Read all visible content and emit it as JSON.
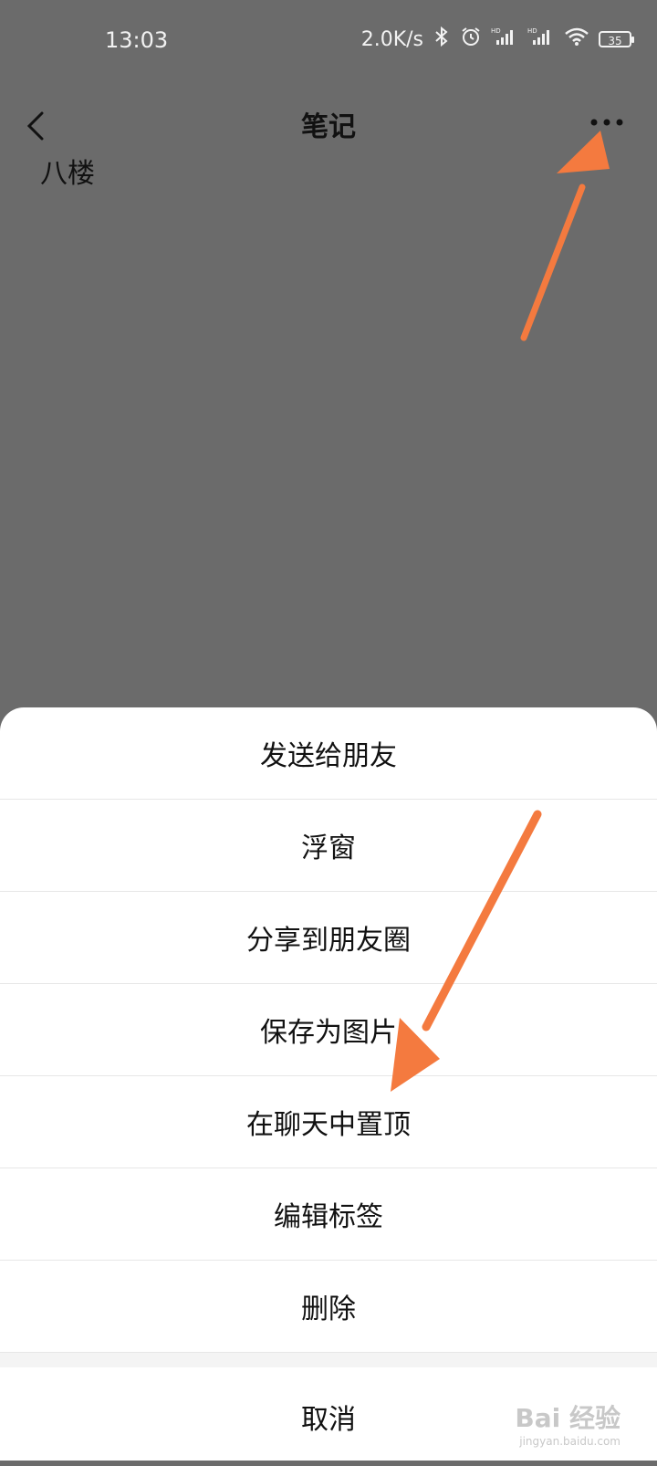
{
  "status_bar": {
    "time": "13:03",
    "net_speed": "2.0K/s",
    "battery": "35",
    "icons": [
      "bluetooth-icon",
      "alarm-icon",
      "signal-hd-icon",
      "signal-hd-icon",
      "wifi-icon",
      "battery-icon"
    ]
  },
  "nav": {
    "title": "笔记"
  },
  "note": {
    "content": "八楼"
  },
  "menu": {
    "items": [
      {
        "label": "发送给朋友"
      },
      {
        "label": "浮窗"
      },
      {
        "label": "分享到朋友圈"
      },
      {
        "label": "保存为图片"
      },
      {
        "label": "在聊天中置顶"
      },
      {
        "label": "编辑标签"
      },
      {
        "label": "删除"
      }
    ],
    "cancel": "取消"
  },
  "watermark": {
    "main": "Bai 经验",
    "sub": "jingyan.baidu.com"
  },
  "colors": {
    "overlay": "#6b6b6b",
    "arrow": "#f47a3f",
    "sheet": "#ffffff"
  }
}
